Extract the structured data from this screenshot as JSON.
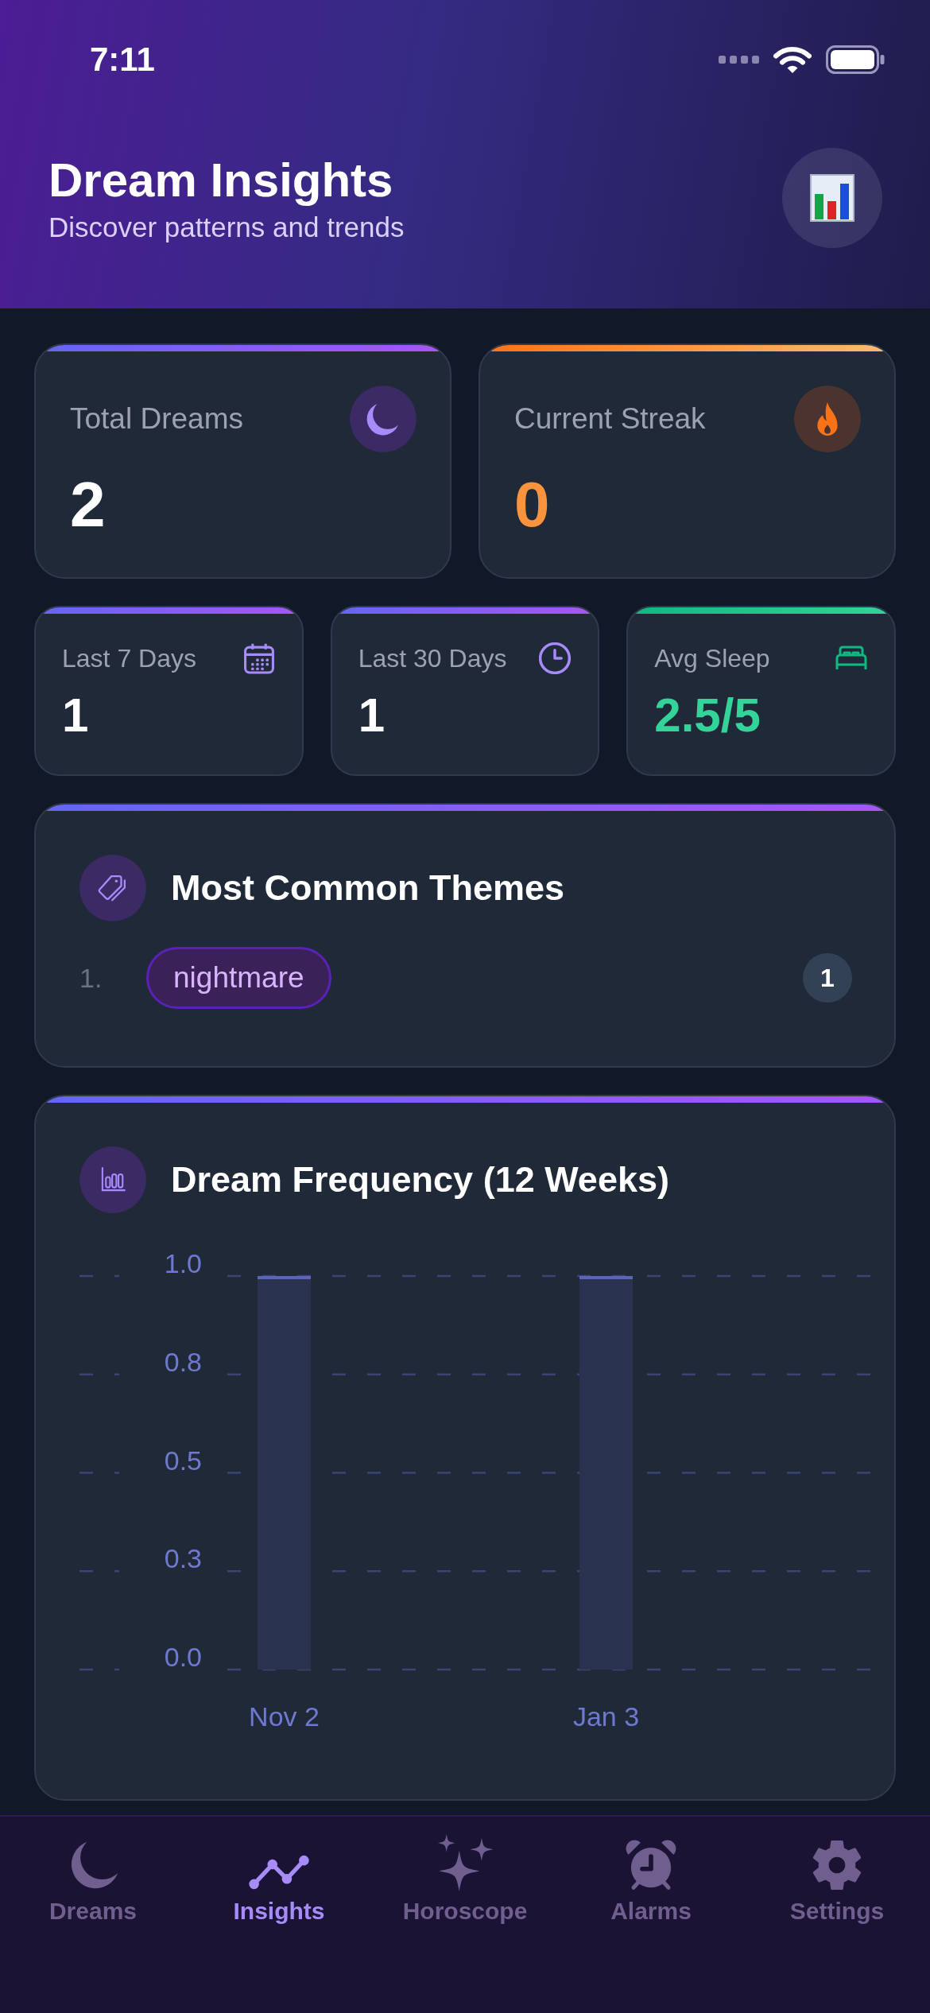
{
  "status_bar": {
    "time": "7:11"
  },
  "header": {
    "title": "Dream Insights",
    "subtitle": "Discover patterns and trends"
  },
  "summary_cards": [
    {
      "kind": "dreams",
      "label": "Total Dreams",
      "value": "2"
    },
    {
      "kind": "streak",
      "label": "Current Streak",
      "value": "0"
    }
  ],
  "period_cards": [
    {
      "kind": "week",
      "label": "Last 7 Days",
      "value": "1"
    },
    {
      "kind": "month",
      "label": "Last 30 Days",
      "value": "1"
    },
    {
      "kind": "sleep",
      "label": "Avg Sleep",
      "value": "2.5/5"
    }
  ],
  "themes": {
    "title": "Most Common Themes",
    "items": [
      {
        "rank": "1.",
        "name": "nightmare",
        "count": "1"
      }
    ]
  },
  "frequency": {
    "title": "Dream Frequency (12 Weeks)",
    "chart_data": {
      "type": "bar",
      "categories": [
        "Nov 2",
        "Jan 3"
      ],
      "values": [
        1,
        1
      ],
      "ylim": [
        0,
        1
      ],
      "yticks": [
        {
          "value": 0,
          "label": "0.0"
        },
        {
          "value": 0.25,
          "label": "0.3"
        },
        {
          "value": 0.5,
          "label": "0.5"
        },
        {
          "value": 0.75,
          "label": "0.8"
        },
        {
          "value": 1,
          "label": "1.0"
        }
      ],
      "grid": true
    }
  },
  "tab_bar": [
    {
      "kind": "dreams",
      "label": "Dreams",
      "selected": false
    },
    {
      "kind": "insights",
      "label": "Insights",
      "selected": true
    },
    {
      "kind": "horoscope",
      "label": "Horoscope",
      "selected": false
    },
    {
      "kind": "alarms",
      "label": "Alarms",
      "selected": false
    },
    {
      "kind": "settings",
      "label": "Settings",
      "selected": false
    }
  ]
}
